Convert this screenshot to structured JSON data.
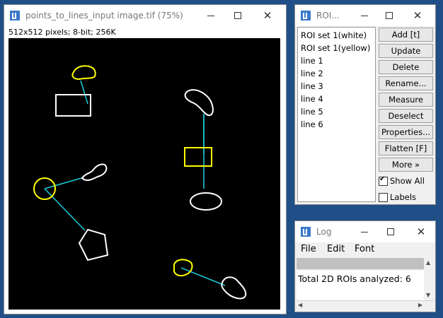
{
  "image_window": {
    "title": "points_to_lines_input image.tif (75%)",
    "info": "512x512 pixels; 8-bit; 256K"
  },
  "roi_window": {
    "title": "ROI...",
    "items": [
      "ROI set 1(white)",
      "ROI set 1(yellow)",
      "line 1",
      "line 2",
      "line 3",
      "line 4",
      "line 5",
      "line 6"
    ],
    "buttons": [
      "Add [t]",
      "Update",
      "Delete",
      "Rename...",
      "Measure",
      "Deselect",
      "Properties...",
      "Flatten [F]",
      "More »"
    ],
    "show_all_label": "Show All",
    "show_all_checked": true,
    "labels_label": "Labels",
    "labels_checked": false
  },
  "log_window": {
    "title": "Log",
    "menu": [
      "File",
      "Edit",
      "Font"
    ],
    "text": "Total 2D ROIs analyzed: 6"
  },
  "colors": {
    "roi_white": "#ffffff",
    "roi_yellow": "#ffff00",
    "line_cyan": "#1ac8d4",
    "canvas": "#000000",
    "desktop": "#1f4f86"
  },
  "icons": {
    "window_icon": "imagej-icon",
    "minimize": "minimize-icon",
    "maximize": "maximize-icon",
    "close": "close-icon"
  }
}
